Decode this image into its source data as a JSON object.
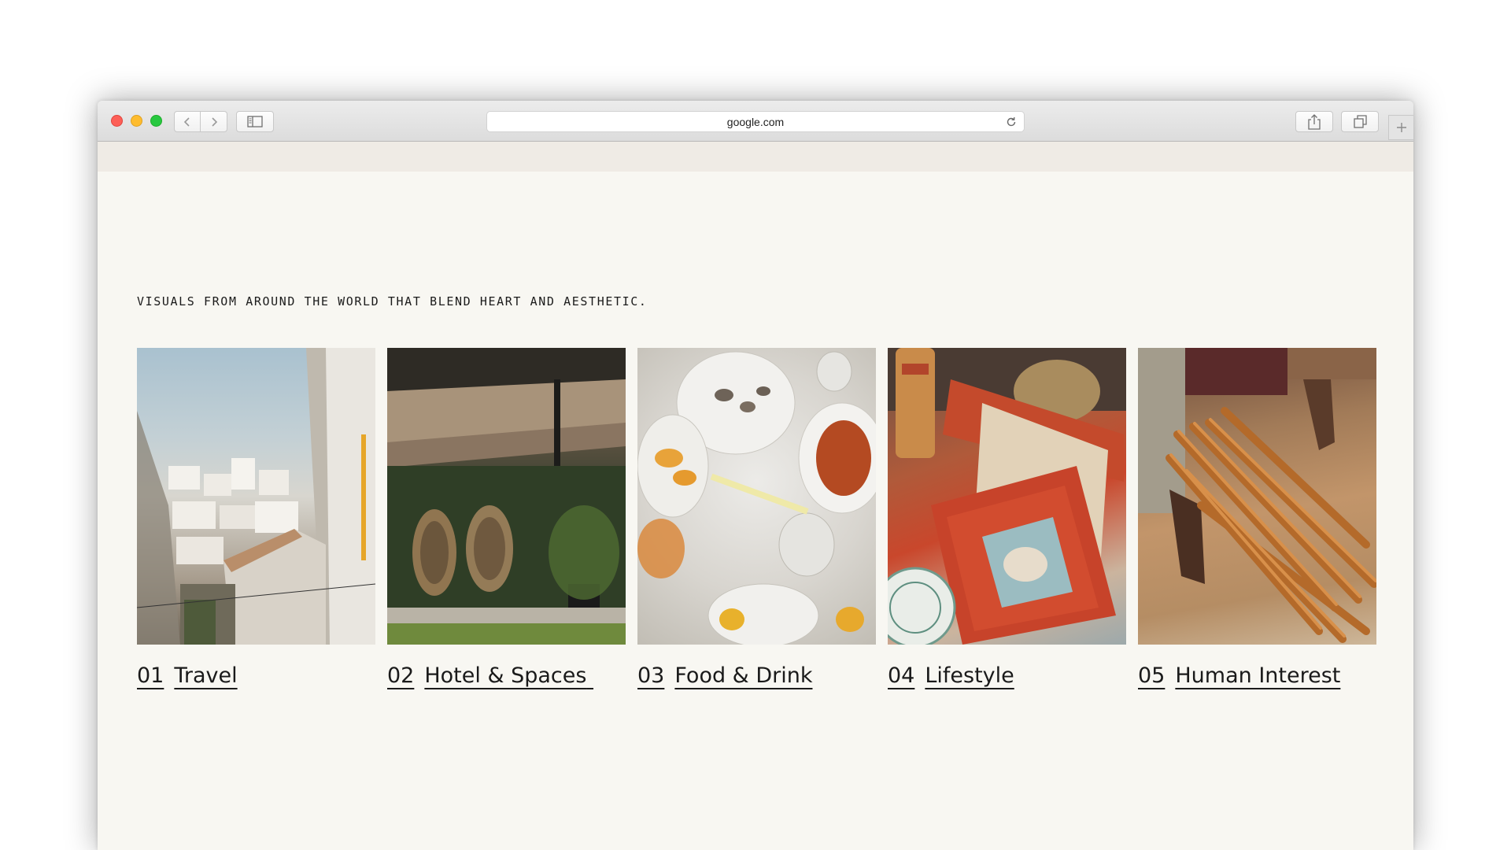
{
  "browser": {
    "address": "google.com"
  },
  "page": {
    "tagline": "VISUALS FROM AROUND THE WORLD THAT BLEND HEART AND AESTHETIC.",
    "categories": [
      {
        "number": "01",
        "label": "Travel"
      },
      {
        "number": "02",
        "label": "Hotel & Spaces"
      },
      {
        "number": "03",
        "label": "Food & Drink"
      },
      {
        "number": "04",
        "label": "Lifestyle"
      },
      {
        "number": "05",
        "label": "Human Interest"
      }
    ]
  }
}
